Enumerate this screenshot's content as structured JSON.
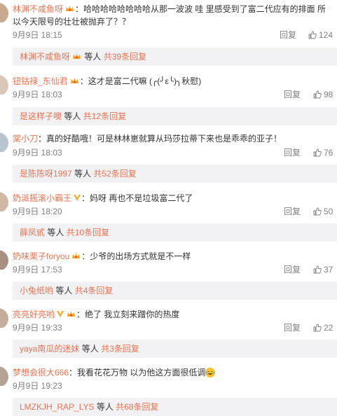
{
  "labels": {
    "reply": "回复",
    "wait": "等人",
    "gong": "共",
    "tiao_reply": "条回复"
  },
  "colors": {
    "username": "#eb7350",
    "text": "#333333",
    "meta": "#808080",
    "sub_bg": "#f2f2f5"
  },
  "comments": [
    {
      "user": "林渊不咸鱼呀",
      "badge_icon": "crown-fan-badge-icon",
      "text": "：哈哈哈哈哈哈哈哈从那一波波 哇 里感受到了富二代应有的排面 所",
      "text2": "以今天限号的壮壮被抛弃了？？",
      "time": "9月9日 18:15",
      "likes": "124",
      "sub_user": "林渊不咸鱼呀",
      "sub_count": "共39条回复"
    },
    {
      "user": "钮钴禄_东仙君",
      "badge_icon": "crown-fan-badge-icon",
      "text": "：这才是富二代嘛 (╭(╯ε╰)╮秋慰)",
      "time": "9月9日 18:03",
      "likes": "98",
      "sub_user": "是这样子噢",
      "sub_count": "共12条回复"
    },
    {
      "user": "棠小刀",
      "text": "：真的好酷哦！可是林林崽就算从玛莎拉蒂下来也是乖乖的亚子！",
      "time": "9月9日 18:03",
      "likes": "76",
      "sub_user": "是陈陈呀1997",
      "sub_count": "共52条回复"
    },
    {
      "user": "奶派摇滚小霸王",
      "badge_icon": "v-verified-icon",
      "text": "：妈呀 再也不是垃圾富二代了",
      "time": "9月9日 18:20",
      "likes": "50",
      "sub_user": "薛凤甙",
      "sub_count": "共10条回复"
    },
    {
      "user": "奶味栗子foryou",
      "badge_icon": "crown-fan-badge-icon",
      "text": "：少爷的出场方式就是不一样",
      "time": "9月9日 17:53",
      "likes": "37",
      "sub_user": "小兔纸哟",
      "sub_count": "共4条回复"
    },
    {
      "user": "亮亮好亮哟",
      "badge_icon": "v-and-crown-badge-icon",
      "text": "：绝了 我立刻来蹭你的热度",
      "time": "9月9日 19:33",
      "likes": "22",
      "sub_user": "yaya南瓜的迷妹",
      "sub_count": "共3条回复"
    },
    {
      "user": "梦想会很大666",
      "text": "：我看花花万物 以为他这方面很低调",
      "time": "9月9日 19:23",
      "likes": "",
      "sub_user": "LMZKJH_RAP_LYS",
      "sub_count": "共68条回复"
    }
  ]
}
